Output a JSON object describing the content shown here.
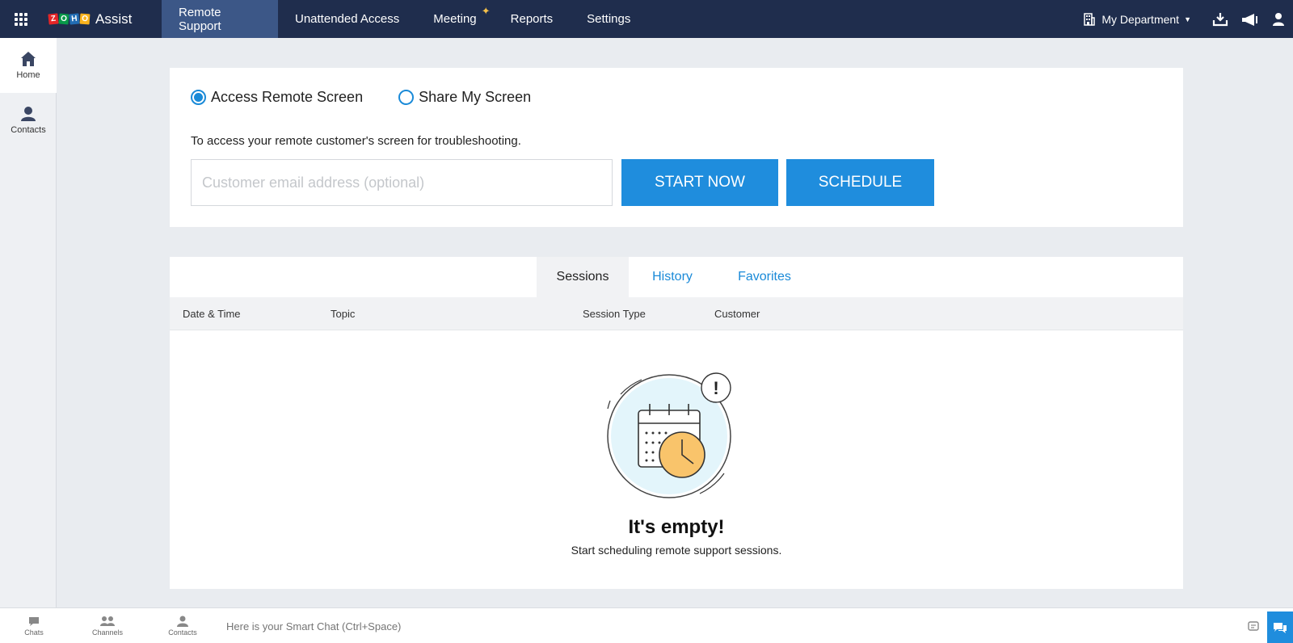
{
  "app": {
    "brand_letters": [
      "Z",
      "O",
      "H",
      "O"
    ],
    "brand_name": "Assist"
  },
  "topnav": {
    "items": [
      {
        "label": "Remote Support",
        "active": true
      },
      {
        "label": "Unattended Access",
        "active": false
      },
      {
        "label": "Meeting",
        "active": false,
        "icon": "sparkle-icon"
      },
      {
        "label": "Reports",
        "active": false
      },
      {
        "label": "Settings",
        "active": false
      }
    ],
    "department": "My Department",
    "right_icons": [
      "download-icon",
      "announcement-icon",
      "user-profile-icon"
    ]
  },
  "sidenav": {
    "items": [
      {
        "label": "Home",
        "icon": "home-icon",
        "active": true
      },
      {
        "label": "Contacts",
        "icon": "contacts-icon",
        "active": false
      }
    ]
  },
  "session_start": {
    "options": [
      {
        "label": "Access Remote Screen",
        "selected": true
      },
      {
        "label": "Share My Screen",
        "selected": false
      }
    ],
    "description": "To access your remote customer's screen for troubleshooting.",
    "email_placeholder": "Customer email address (optional)",
    "email_value": "",
    "start_label": "START NOW",
    "schedule_label": "SCHEDULE"
  },
  "sessions_panel": {
    "tabs": [
      {
        "label": "Sessions",
        "active": true
      },
      {
        "label": "History",
        "active": false
      },
      {
        "label": "Favorites",
        "active": false
      }
    ],
    "columns": [
      "Date & Time",
      "Topic",
      "Session Type",
      "Customer"
    ],
    "rows": [],
    "empty_title": "It's empty!",
    "empty_subtitle": "Start scheduling remote support sessions.",
    "empty_badge": "!"
  },
  "bottombar": {
    "items": [
      {
        "label": "Chats",
        "icon": "chat-icon"
      },
      {
        "label": "Channels",
        "icon": "channels-icon"
      },
      {
        "label": "Contacts",
        "icon": "contacts-icon"
      }
    ],
    "smart_chat_placeholder": "Here is your Smart Chat (Ctrl+Space)"
  },
  "colors": {
    "topbar_bg": "#1f2d4d",
    "active_tab_bg": "#3c5787",
    "accent_blue": "#1f8ddd",
    "page_bg": "#e9ecf0"
  }
}
